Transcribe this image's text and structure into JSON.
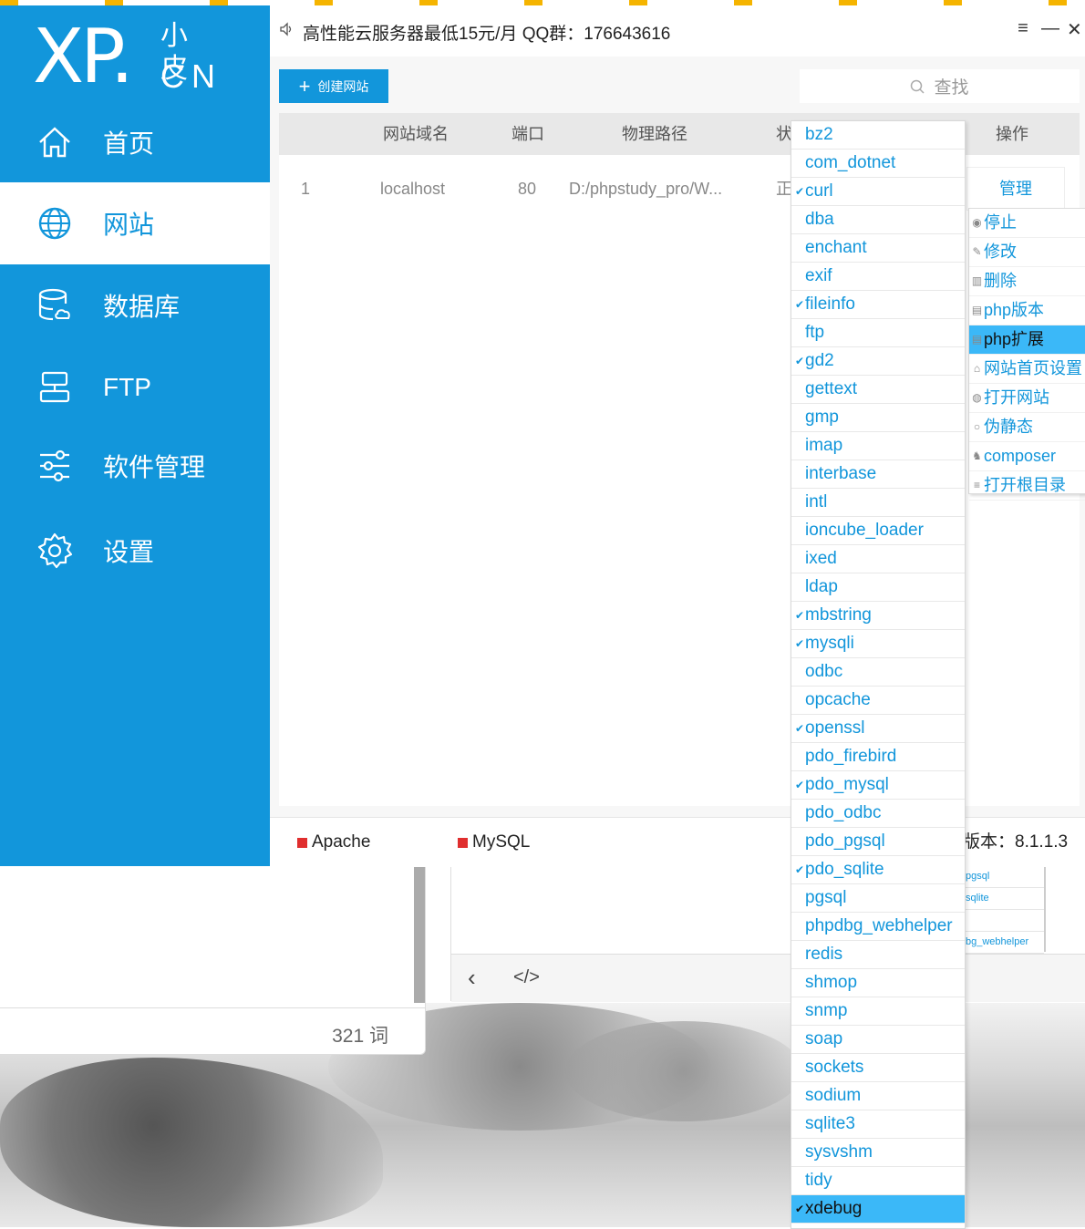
{
  "notice": "高性能云服务器最低15元/月  QQ群：176643616",
  "window_controls": [
    "≡",
    "—",
    "✕"
  ],
  "logo": {
    "main": "XP.",
    "small": "小皮",
    "cn": "CN"
  },
  "sidebar": {
    "items": [
      {
        "label": "首页",
        "icon": "home-icon"
      },
      {
        "label": "网站",
        "icon": "globe-icon",
        "active": true
      },
      {
        "label": "数据库",
        "icon": "database-icon"
      },
      {
        "label": "FTP",
        "icon": "ftp-icon"
      },
      {
        "label": "软件管理",
        "icon": "sliders-icon"
      },
      {
        "label": "设置",
        "icon": "gear-icon"
      }
    ]
  },
  "toolbar": {
    "create_label": "创建网站",
    "search_placeholder": "查找"
  },
  "table": {
    "headers": {
      "domain": "网站域名",
      "port": "端口",
      "path": "物理路径",
      "status": "状",
      "action": "操作"
    },
    "rows": [
      {
        "index": "1",
        "domain": "localhost",
        "port": "80",
        "path": "D:/phpstudy_pro/W...",
        "status": "正",
        "action": "管理"
      }
    ]
  },
  "context_menu": {
    "items": [
      {
        "label": "停止",
        "icon": "stop-icon"
      },
      {
        "label": "修改",
        "icon": "edit-icon"
      },
      {
        "label": "删除",
        "icon": "trash-icon"
      },
      {
        "label": "php版本",
        "icon": "php-version-icon"
      },
      {
        "label": "php扩展",
        "icon": "php-extension-icon",
        "highlighted": true
      },
      {
        "label": "网站首页设置",
        "icon": "home-icon"
      },
      {
        "label": "打开网站",
        "icon": "globe-icon"
      },
      {
        "label": "伪静态",
        "icon": "rewrite-icon"
      },
      {
        "label": "composer",
        "icon": "composer-icon"
      },
      {
        "label": "打开根目录",
        "icon": "list-icon"
      }
    ]
  },
  "extensions": [
    {
      "name": "bz2",
      "checked": false
    },
    {
      "name": "com_dotnet",
      "checked": false
    },
    {
      "name": "curl",
      "checked": true
    },
    {
      "name": "dba",
      "checked": false
    },
    {
      "name": "enchant",
      "checked": false
    },
    {
      "name": "exif",
      "checked": false
    },
    {
      "name": "fileinfo",
      "checked": true
    },
    {
      "name": "ftp",
      "checked": false
    },
    {
      "name": "gd2",
      "checked": true
    },
    {
      "name": "gettext",
      "checked": false
    },
    {
      "name": "gmp",
      "checked": false
    },
    {
      "name": "imap",
      "checked": false
    },
    {
      "name": "interbase",
      "checked": false
    },
    {
      "name": "intl",
      "checked": false
    },
    {
      "name": "ioncube_loader",
      "checked": false
    },
    {
      "name": "ixed",
      "checked": false
    },
    {
      "name": "ldap",
      "checked": false
    },
    {
      "name": "mbstring",
      "checked": true
    },
    {
      "name": "mysqli",
      "checked": true
    },
    {
      "name": "odbc",
      "checked": false
    },
    {
      "name": "opcache",
      "checked": false
    },
    {
      "name": "openssl",
      "checked": true
    },
    {
      "name": "pdo_firebird",
      "checked": false
    },
    {
      "name": "pdo_mysql",
      "checked": true
    },
    {
      "name": "pdo_odbc",
      "checked": false
    },
    {
      "name": "pdo_pgsql",
      "checked": false
    },
    {
      "name": "pdo_sqlite",
      "checked": true
    },
    {
      "name": "pgsql",
      "checked": false
    },
    {
      "name": "phpdbg_webhelper",
      "checked": false
    },
    {
      "name": "redis",
      "checked": false
    },
    {
      "name": "shmop",
      "checked": false
    },
    {
      "name": "snmp",
      "checked": false
    },
    {
      "name": "soap",
      "checked": false
    },
    {
      "name": "sockets",
      "checked": false
    },
    {
      "name": "sodium",
      "checked": false
    },
    {
      "name": "sqlite3",
      "checked": false
    },
    {
      "name": "sysvshm",
      "checked": false
    },
    {
      "name": "tidy",
      "checked": false
    },
    {
      "name": "xdebug",
      "checked": true,
      "highlighted": true
    }
  ],
  "statusbar": {
    "services": [
      {
        "name": "Apache",
        "status_color": "#e02e2e"
      },
      {
        "name": "MySQL",
        "status_color": "#e02e2e"
      }
    ],
    "version": "版本：8.1.1.3"
  },
  "background_window": {
    "word_count": "321 词",
    "mini_list": [
      "pgsql",
      "sqlite",
      "",
      "bg_webhelper"
    ]
  },
  "colors": {
    "accent": "#1296db",
    "highlight": "#3bb8f8",
    "stopped": "#e02e2e"
  }
}
